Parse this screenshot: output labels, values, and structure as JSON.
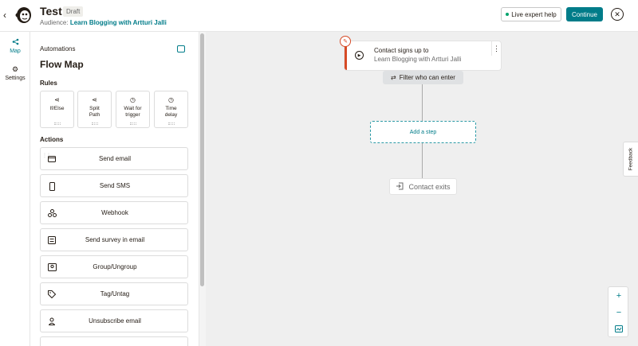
{
  "header": {
    "back_glyph": "‹",
    "title": "Test",
    "badge": "Draft",
    "audience_label": "Audience:",
    "audience_value": "Learn Blogging with Artturi Jalli",
    "live_help_label": "Live expert help",
    "continue_label": "Continue",
    "close_glyph": "✕"
  },
  "rail": {
    "items": [
      {
        "label": "Map",
        "icon": "flow-icon"
      },
      {
        "label": "Settings",
        "icon": "gear-icon"
      }
    ]
  },
  "panel": {
    "label": "Automations",
    "title": "Flow Map",
    "rules_heading": "Rules",
    "rules": [
      {
        "label": "If/Else",
        "icon": "branch-icon"
      },
      {
        "label": "Split\nPath",
        "icon": "split-icon"
      },
      {
        "label": "Wait for\ntrigger",
        "icon": "clock-icon"
      },
      {
        "label": "Time\ndelay",
        "icon": "timer-icon"
      }
    ],
    "actions_heading": "Actions",
    "actions": [
      {
        "label": "Send email",
        "icon": "email-icon"
      },
      {
        "label": "Send SMS",
        "icon": "phone-icon"
      },
      {
        "label": "Webhook",
        "icon": "webhook-icon"
      },
      {
        "label": "Send survey in email",
        "icon": "survey-icon"
      },
      {
        "label": "Group/Ungroup",
        "icon": "group-icon"
      },
      {
        "label": "Tag/Untag",
        "icon": "tag-icon"
      },
      {
        "label": "Unsubscribe email",
        "icon": "unsubscribe-icon"
      }
    ]
  },
  "canvas": {
    "trigger_line1": "Contact signs up to",
    "trigger_line2": "Learn Blogging with Artturi Jalli",
    "filter_label": "Filter who can enter",
    "add_step_label": "Add a step",
    "exit_label": "Contact exits",
    "feedback_label": "Feedback",
    "zoom_in": "+",
    "zoom_out": "−"
  },
  "colors": {
    "brand_teal": "#007c89",
    "trigger_accent": "#d64a26",
    "canvas_bg": "#efefef"
  }
}
